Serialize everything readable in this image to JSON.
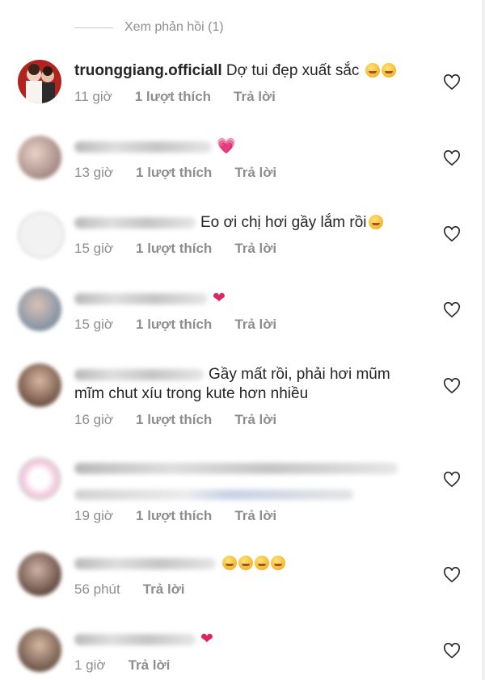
{
  "view_replies": "Xem phản hồi (1)",
  "comments": [
    {
      "username": "truonggiang.officiall",
      "text": "Dợ tui đẹp xuất sắc",
      "time": "11 giờ",
      "likes": "1 lượt thích",
      "reply": "Trả lời"
    },
    {
      "username": "",
      "text": "",
      "time": "13 giờ",
      "likes": "1 lượt thích",
      "reply": "Trả lời"
    },
    {
      "username": "",
      "text": "Eo ơi chị hơi gầy lắm rồi",
      "time": "15 giờ",
      "likes": "1 lượt thích",
      "reply": "Trả lời"
    },
    {
      "username": "",
      "text": "",
      "time": "15 giờ",
      "likes": "1 lượt thích",
      "reply": "Trả lời"
    },
    {
      "username": "",
      "text": "Gầy mất rồi, phải hơi mũm",
      "text2": "mĩm chut xíu trong kute hơn nhiều",
      "time": "16 giờ",
      "likes": "1 lượt thích",
      "reply": "Trả lời"
    },
    {
      "username": "",
      "text": "",
      "time": "19 giờ",
      "likes": "1 lượt thích",
      "reply": "Trả lời"
    },
    {
      "username": "",
      "text": "",
      "time": "56 phút",
      "reply": "Trả lời"
    },
    {
      "username": "",
      "text": "",
      "time": "1 giờ",
      "reply": "Trả lời"
    }
  ],
  "icons": {
    "like": "heart-outline-icon",
    "emoji_kiss": "kissing-face-icon",
    "emoji_sad": "pleading-face-icon",
    "emoji_love": "heart-eyes-face-icon",
    "red_heart": "red-heart-icon",
    "pink_heart": "pink-heart-icon"
  },
  "colors": {
    "muted": "#8e8e8e",
    "text": "#262626",
    "heart": "#e0245e"
  }
}
